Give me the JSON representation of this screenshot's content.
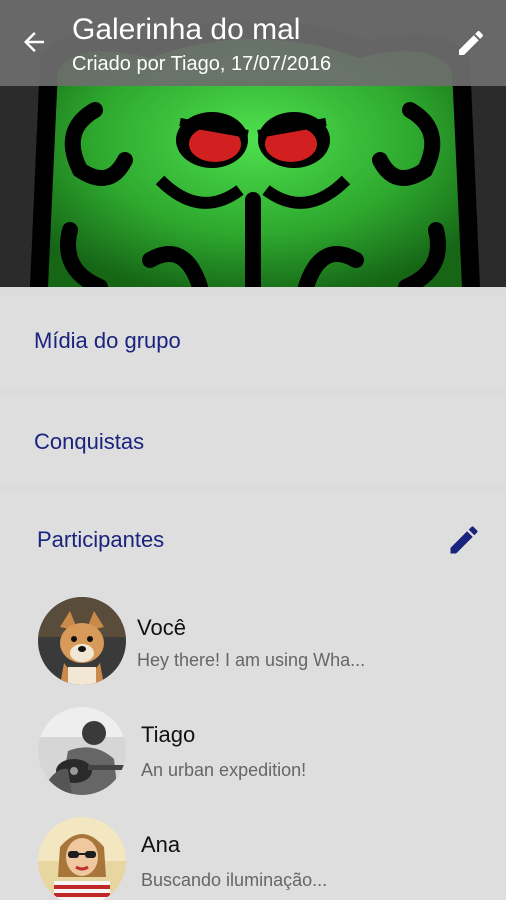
{
  "appbar": {
    "title": "Galerinha do mal",
    "subtitle": "Criado por Tiago, 17/07/2016",
    "back_icon": "arrow-left-icon",
    "edit_icon": "pencil-icon"
  },
  "header_image": {
    "description_icon": "octopus-group-image"
  },
  "sections": {
    "media_label": "Mídia do grupo",
    "achievements_label": "Conquistas",
    "participants_label": "Participantes"
  },
  "participants": [
    {
      "name": "Você",
      "status": "Hey there! I am using Wha..."
    },
    {
      "name": "Tiago",
      "status": "An urban expedition!"
    },
    {
      "name": "Ana",
      "status": "Buscando iluminação..."
    }
  ],
  "colors": {
    "accent": "#1a237e",
    "appbar": "#6e6e6e",
    "background": "#dedede",
    "octopus_green": "#33b233",
    "eyes": "#d22020"
  }
}
